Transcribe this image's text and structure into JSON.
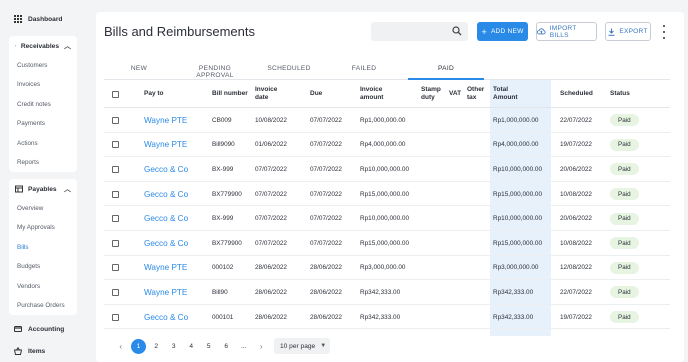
{
  "sidebar": {
    "dashboard": "Dashboard",
    "receivables": {
      "label": "Receivables",
      "items": [
        "Customers",
        "Invoices",
        "Credit notes",
        "Payments",
        "Actions",
        "Reports"
      ]
    },
    "payables": {
      "label": "Payables",
      "items": [
        "Overview",
        "My Approvals",
        "Bills",
        "Budgets",
        "Vendors",
        "Purchase Orders"
      ],
      "active": "Bills"
    },
    "accounting": "Accounting",
    "items_label": "Items"
  },
  "header": {
    "title": "Bills and Reimbursements",
    "search_placeholder": "",
    "add_label": "ADD NEW",
    "import_label": "IMPORT BILLS",
    "export_label": "EXPORT"
  },
  "tabs": [
    "NEW",
    "PENDING APPROVAL",
    "SCHEDULED",
    "FAILED",
    "PAID"
  ],
  "active_tab": "PAID",
  "table": {
    "columns": {
      "pay_to": "Pay to",
      "bill_number": "Bill number",
      "invoice_date": "Invoice date",
      "due": "Due",
      "invoice_amount": "Invoice amount",
      "stamp_duty": "Stamp duty",
      "vat": "VAT",
      "other_tax": "Other tax",
      "total_amount": "Total Amount",
      "scheduled": "Scheduled",
      "status": "Status"
    },
    "rows": [
      {
        "pay_to": "Wayne PTE",
        "bill": "CB009",
        "invoice_date": "10/08/2022",
        "due": "07/07/2022",
        "amount": "Rp1,000,000.00",
        "total": "Rp1,000,000.00",
        "scheduled": "22/07/2022",
        "status": "Paid"
      },
      {
        "pay_to": "Wayne PTE",
        "bill": "Bill9090",
        "invoice_date": "01/06/2022",
        "due": "07/07/2022",
        "amount": "Rp4,000,000.00",
        "total": "Rp4,000,000.00",
        "scheduled": "19/07/2022",
        "status": "Paid"
      },
      {
        "pay_to": "Gecco & Co",
        "bill": "BX-999",
        "invoice_date": "07/07/2022",
        "due": "07/07/2022",
        "amount": "Rp10,000,000.00",
        "total": "Rp10,000,000.00",
        "scheduled": "20/06/2022",
        "status": "Paid"
      },
      {
        "pay_to": "Gecco & Co",
        "bill": "BX779900",
        "invoice_date": "07/07/2022",
        "due": "07/07/2022",
        "amount": "Rp15,000,000.00",
        "total": "Rp15,000,000.00",
        "scheduled": "10/08/2022",
        "status": "Paid"
      },
      {
        "pay_to": "Gecco & Co",
        "bill": "BX-999",
        "invoice_date": "07/07/2022",
        "due": "07/07/2022",
        "amount": "Rp10,000,000.00",
        "total": "Rp10,000,000.00",
        "scheduled": "20/06/2022",
        "status": "Paid"
      },
      {
        "pay_to": "Gecco & Co",
        "bill": "BX779900",
        "invoice_date": "07/07/2022",
        "due": "07/07/2022",
        "amount": "Rp15,000,000.00",
        "total": "Rp15,000,000.00",
        "scheduled": "10/08/2022",
        "status": "Paid"
      },
      {
        "pay_to": "Wayne PTE",
        "bill": "000102",
        "invoice_date": "28/06/2022",
        "due": "28/06/2022",
        "amount": "Rp3,000,000.00",
        "total": "Rp3,000,000.00",
        "scheduled": "12/08/2022",
        "status": "Paid"
      },
      {
        "pay_to": "Wayne PTE",
        "bill": "Bill90",
        "invoice_date": "28/06/2022",
        "due": "28/06/2022",
        "amount": "Rp342,333.00",
        "total": "Rp342,333.00",
        "scheduled": "22/07/2022",
        "status": "Paid"
      },
      {
        "pay_to": "Gecco & Co",
        "bill": "000101",
        "invoice_date": "28/06/2022",
        "due": "28/06/2022",
        "amount": "Rp342,333.00",
        "total": "Rp342,333.00",
        "scheduled": "19/07/2022",
        "status": "Paid"
      }
    ]
  },
  "pagination": {
    "prev": "‹",
    "pages": [
      "1",
      "2",
      "3",
      "4",
      "5",
      "6",
      "..."
    ],
    "current": "1",
    "next": "›",
    "per_page": "10 per page"
  },
  "colors": {
    "accent": "#2a8ae8",
    "highlight_column": "#e6f1fc",
    "paid_badge": "#e7f4e2"
  }
}
